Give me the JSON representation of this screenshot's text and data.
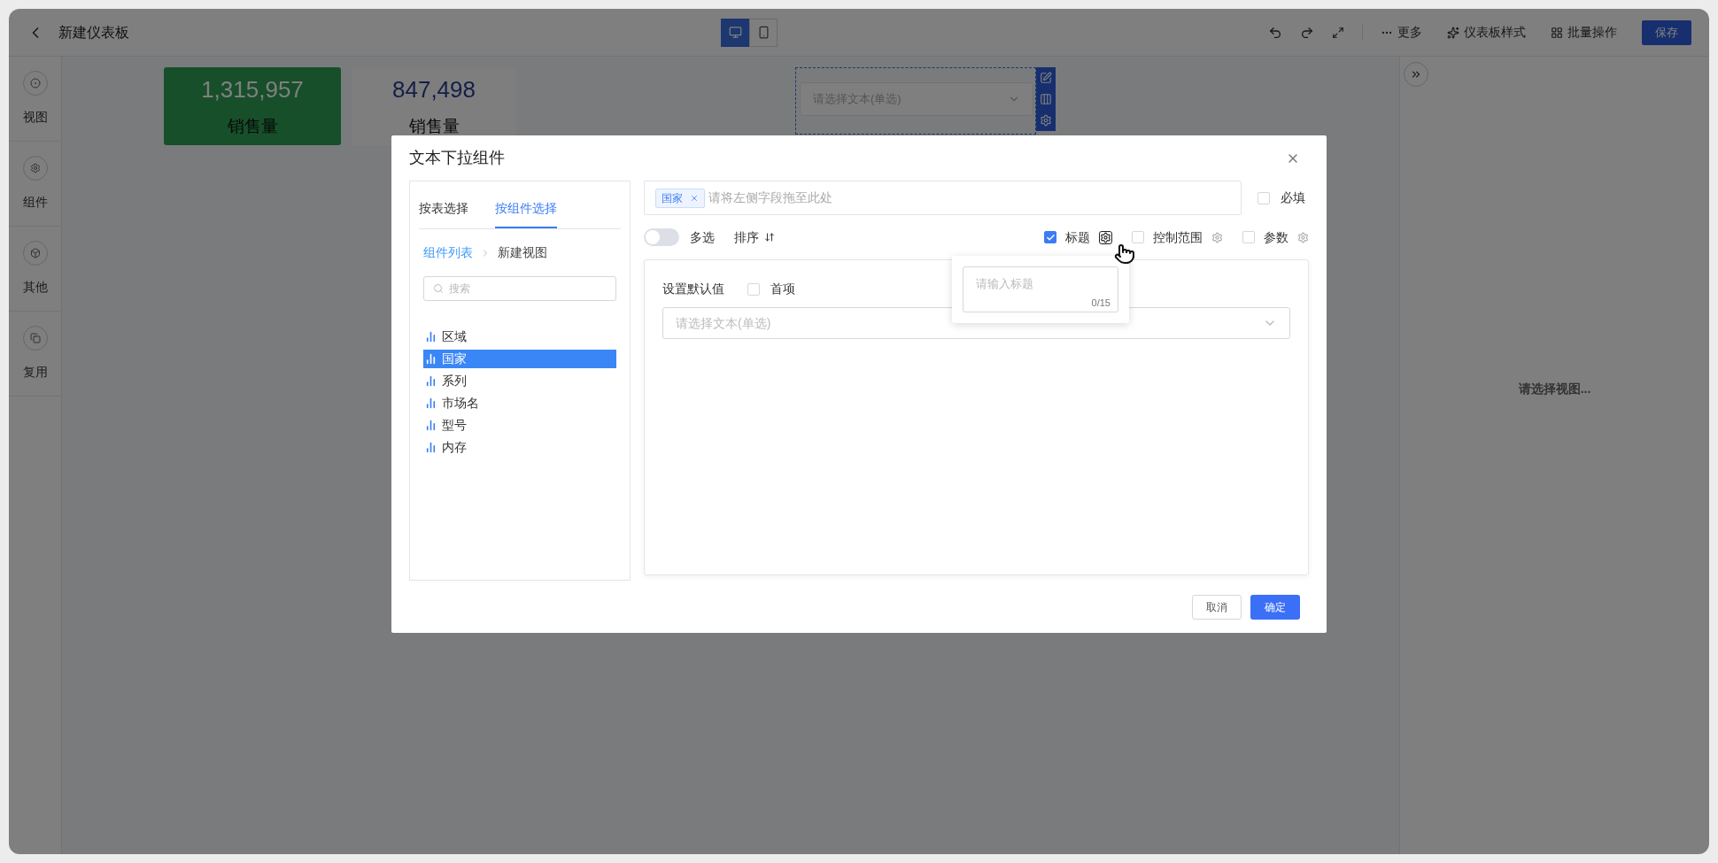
{
  "topbar": {
    "title": "新建仪表板",
    "view_modes": [
      {
        "kind": "desktop",
        "selected": true
      },
      {
        "kind": "mobile",
        "selected": false
      }
    ],
    "actions": [
      {
        "kind": "more",
        "label": "更多"
      },
      {
        "kind": "style",
        "label": "仪表板样式"
      },
      {
        "kind": "batch",
        "label": "批量操作"
      }
    ],
    "save": "保存"
  },
  "sidebar": [
    {
      "kind": "view",
      "label": "视图"
    },
    {
      "kind": "component",
      "label": "组件"
    },
    {
      "kind": "other",
      "label": "其他"
    },
    {
      "kind": "reuse",
      "label": "复用"
    }
  ],
  "kpi_cards": [
    {
      "kind": "highlight",
      "value": "1,315,957",
      "label": "销售量"
    },
    {
      "kind": "plain",
      "value": "847,498",
      "label": "销售量"
    }
  ],
  "filter_widget": {
    "placeholder": "请选择文本(单选)"
  },
  "right_panel": {
    "message": "请选择视图..."
  },
  "dialog": {
    "title": "文本下拉组件",
    "tabs": [
      {
        "label": "按表选择",
        "selected": false
      },
      {
        "label": "按组件选择",
        "selected": true
      }
    ],
    "breadcrumb": [
      "组件列表",
      "新建视图"
    ],
    "search": {
      "placeholder": "搜索"
    },
    "fields": [
      {
        "name": "区域",
        "selected": false
      },
      {
        "name": "国家",
        "selected": true
      },
      {
        "name": "系列",
        "selected": false
      },
      {
        "name": "市场名",
        "selected": false
      },
      {
        "name": "型号",
        "selected": false
      },
      {
        "name": "内存",
        "selected": false
      }
    ],
    "drop_zone": {
      "tags": [
        "国家"
      ],
      "placeholder": "请将左侧字段拖至此处"
    },
    "required": {
      "label": "必填",
      "checked": false
    },
    "multi_select": {
      "label": "多选",
      "on": false
    },
    "sort": "排序",
    "options": [
      {
        "label": "标题",
        "checked": true
      },
      {
        "label": "控制范围",
        "checked": false
      },
      {
        "label": "参数",
        "checked": false
      }
    ],
    "default_value": {
      "label": "设置默认值",
      "first_item": {
        "label": "首项",
        "checked": false
      },
      "placeholder": "请选择文本(单选)"
    },
    "title_popover": {
      "placeholder": "请输入标题",
      "counter": "0/15"
    },
    "buttons": [
      {
        "kind": "secondary",
        "label": "取消"
      },
      {
        "kind": "primary",
        "label": "确定"
      }
    ]
  }
}
